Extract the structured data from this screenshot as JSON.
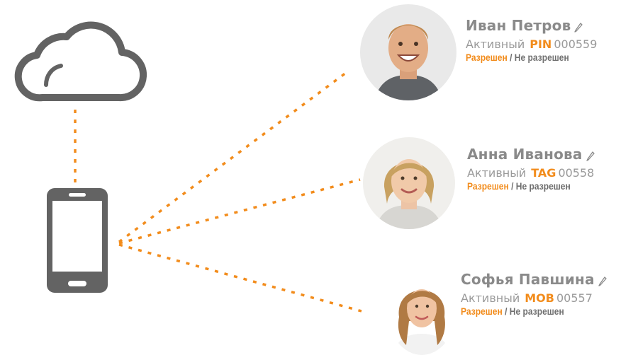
{
  "colors": {
    "accent": "#f28c1c",
    "icon": "#636363",
    "name": "#8a8a8a",
    "muted": "#9a9a9a",
    "dark": "#6f6f6f"
  },
  "icons": {
    "cloud": "cloud-icon",
    "phone": "smartphone-icon",
    "edit": "pencil-icon"
  },
  "users": [
    {
      "name": "Иван Петров",
      "status": "Активный",
      "code": "PIN",
      "number": "000559",
      "allowed": "Разрешен",
      "separator": "/",
      "denied": "Не разрешен"
    },
    {
      "name": "Анна Иванова",
      "status": "Активный",
      "code": "TAG",
      "number": "00558",
      "allowed": "Разрешен",
      "separator": "/",
      "denied": "Не разрешен"
    },
    {
      "name": "Софья Павшина",
      "status": "Активный",
      "code": "MOB",
      "number": "00557",
      "allowed": "Разрешен",
      "separator": "/",
      "denied": "Не разрешен"
    }
  ]
}
